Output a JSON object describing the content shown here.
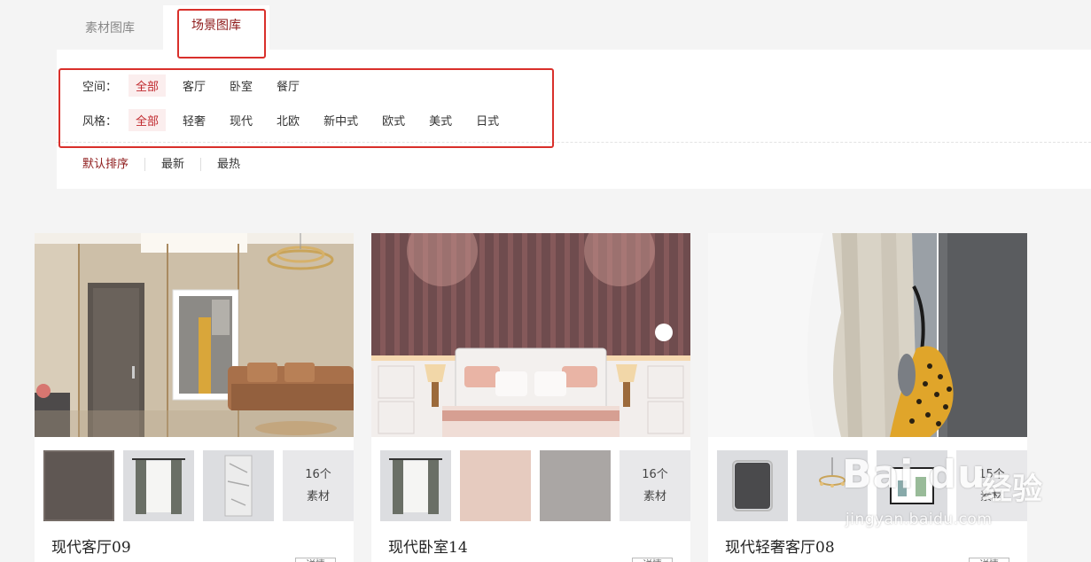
{
  "tabs": [
    {
      "label": "素材图库",
      "active": false
    },
    {
      "label": "场景图库",
      "active": true
    }
  ],
  "filters": {
    "space": {
      "label": "空间：",
      "options": [
        "全部",
        "客厅",
        "卧室",
        "餐厅"
      ],
      "selected": "全部"
    },
    "style": {
      "label": "风格：",
      "options": [
        "全部",
        "轻奢",
        "现代",
        "北欧",
        "新中式",
        "欧式",
        "美式",
        "日式"
      ],
      "selected": "全部"
    }
  },
  "sort": {
    "options": [
      "默认排序",
      "最新",
      "最热"
    ],
    "selected": "默认排序"
  },
  "cards": [
    {
      "title": "现代客厅09",
      "more_count": "16个",
      "more_label": "素材",
      "tag": "详情"
    },
    {
      "title": "现代卧室14",
      "more_count": "16个",
      "more_label": "素材",
      "tag": "详情"
    },
    {
      "title": "现代轻奢客厅08",
      "more_count": "15个",
      "more_label": "素材",
      "tag": "详情"
    }
  ],
  "watermark": {
    "logo": "Bai du",
    "cn": "经验",
    "url": "jingyan.baidu.com"
  },
  "colors": {
    "accent": "#8e1a1a",
    "selected_bg": "#fbeeee",
    "highlight": "#d9302b"
  }
}
